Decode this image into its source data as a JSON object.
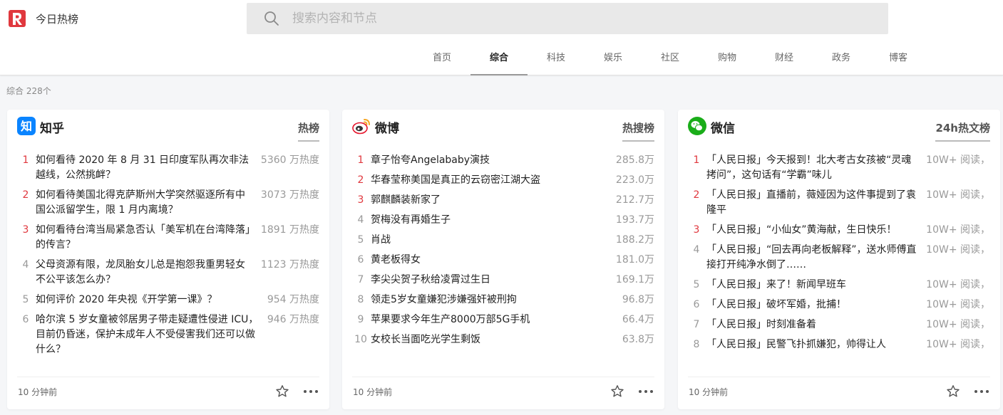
{
  "header": {
    "site_name": "今日热榜",
    "logo_icon": "tophub-logo-icon",
    "brand_color": "#e0383e",
    "search_placeholder": "搜索内容和节点"
  },
  "nav": {
    "items": [
      {
        "label": "首页",
        "active": false
      },
      {
        "label": "综合",
        "active": true
      },
      {
        "label": "科技",
        "active": false
      },
      {
        "label": "娱乐",
        "active": false
      },
      {
        "label": "社区",
        "active": false
      },
      {
        "label": "购物",
        "active": false
      },
      {
        "label": "财经",
        "active": false
      },
      {
        "label": "政务",
        "active": false
      },
      {
        "label": "博客",
        "active": false
      }
    ]
  },
  "section": {
    "count_label": "综合 228个"
  },
  "cards": [
    {
      "source": "知乎",
      "icon": "zhihu-icon",
      "tab": "热榜",
      "time": "10 分钟前",
      "items": [
        {
          "rank": "1",
          "title": "如何看待 2020 年 8 月 31 日印度军队再次非法越线，公然挑衅？",
          "heat": "5360 万热度"
        },
        {
          "rank": "2",
          "title": "如何看待美国北得克萨斯州大学突然驱逐所有中国公派留学生，限 1 月内离境？",
          "heat": "3073 万热度"
        },
        {
          "rank": "3",
          "title": "如何看待台湾当局紧急否认「美军机在台湾降落」的传言？",
          "heat": "1891 万热度"
        },
        {
          "rank": "4",
          "title": "父母资源有限，龙凤胎女儿总是抱怨我重男轻女不公平该怎么办？",
          "heat": "1123 万热度"
        },
        {
          "rank": "5",
          "title": "如何评价 2020 年央视《开学第一课》？",
          "heat": "954 万热度"
        },
        {
          "rank": "6",
          "title": "哈尔滨 5 岁女童被邻居男子带走疑遭性侵进 ICU，目前仍昏迷，保护未成年人不受侵害我们还可以做什么？",
          "heat": "946 万热度"
        }
      ]
    },
    {
      "source": "微博",
      "icon": "weibo-icon",
      "tab": "热搜榜",
      "time": "10 分钟前",
      "items": [
        {
          "rank": "1",
          "title": "章子怡夸Angelababy演技",
          "heat": "285.8万"
        },
        {
          "rank": "2",
          "title": "华春莹称美国是真正的云窃密江湖大盗",
          "heat": "223.0万"
        },
        {
          "rank": "3",
          "title": "郭麒麟装新家了",
          "heat": "212.7万"
        },
        {
          "rank": "4",
          "title": "贺梅没有再婚生子",
          "heat": "193.7万"
        },
        {
          "rank": "5",
          "title": "肖战",
          "heat": "188.2万"
        },
        {
          "rank": "6",
          "title": "黄老板得女",
          "heat": "181.0万"
        },
        {
          "rank": "7",
          "title": "李尖尖贺子秋给凌霄过生日",
          "heat": "169.1万"
        },
        {
          "rank": "8",
          "title": "领走5岁女童嫌犯涉嫌强奸被刑拘",
          "heat": "96.8万"
        },
        {
          "rank": "9",
          "title": "苹果要求今年生产8000万部5G手机",
          "heat": "66.4万"
        },
        {
          "rank": "10",
          "title": "女校长当面吃光学生剩饭",
          "heat": "63.8万"
        }
      ]
    },
    {
      "source": "微信",
      "icon": "wechat-icon",
      "tab": "24h热文榜",
      "time": "10 分钟前",
      "items": [
        {
          "rank": "1",
          "title": "「人民日报」今天报到！北大考古女孩被“灵魂拷问”，这句话有“学霸”味儿",
          "heat": "10W+ 阅读，"
        },
        {
          "rank": "2",
          "title": "「人民日报」直播前，薇娅因为这件事提到了袁隆平",
          "heat": "10W+ 阅读，"
        },
        {
          "rank": "3",
          "title": "「人民日报」“小仙女”黄海献，生日快乐！",
          "heat": "10W+ 阅读，"
        },
        {
          "rank": "4",
          "title": "「人民日报」“回去再向老板解释”，送水师傅直接打开纯净水倒了……",
          "heat": "10W+ 阅读，"
        },
        {
          "rank": "5",
          "title": "「人民日报」来了！新闻早班车",
          "heat": "10W+ 阅读，"
        },
        {
          "rank": "6",
          "title": "「人民日报」破坏军婚，批捕！",
          "heat": "10W+ 阅读，"
        },
        {
          "rank": "7",
          "title": "「人民日报」时刻准备着",
          "heat": "10W+ 阅读，"
        },
        {
          "rank": "8",
          "title": "「人民日报」民警飞扑抓嫌犯，帅得让人",
          "heat": "10W+ 阅读，"
        }
      ]
    }
  ]
}
